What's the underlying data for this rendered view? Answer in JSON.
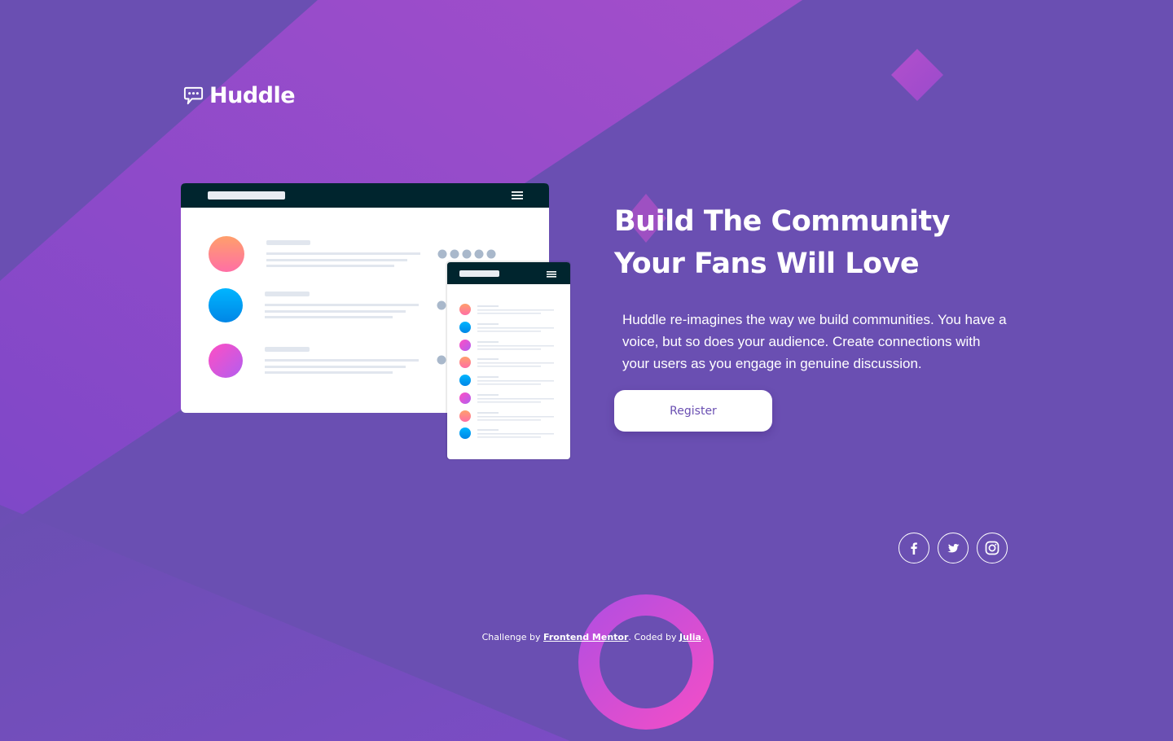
{
  "brand": {
    "name": "Huddle"
  },
  "hero": {
    "title_line1": "Build The Community",
    "title_line2": "Your Fans Will Love",
    "description": "Huddle re-imagines the way we build communities. You have a voice, but so does your audience. Create connections with your users as you engage in genuine discussion.",
    "register_label": "Register"
  },
  "social": [
    {
      "icon": "facebook-icon"
    },
    {
      "icon": "twitter-icon"
    },
    {
      "icon": "instagram-icon"
    }
  ],
  "footer": {
    "prefix": "Challenge by ",
    "frontend_mentor": "Frontend Mentor",
    "middle": ". Coded by ",
    "author": "Julia",
    "suffix": "."
  },
  "colors": {
    "background": "#6a4fb2",
    "accent_pink": "#e94ec8",
    "accent_purple": "#b45be0",
    "button_text": "#6a4fb2",
    "mockup_header": "#00252e"
  }
}
